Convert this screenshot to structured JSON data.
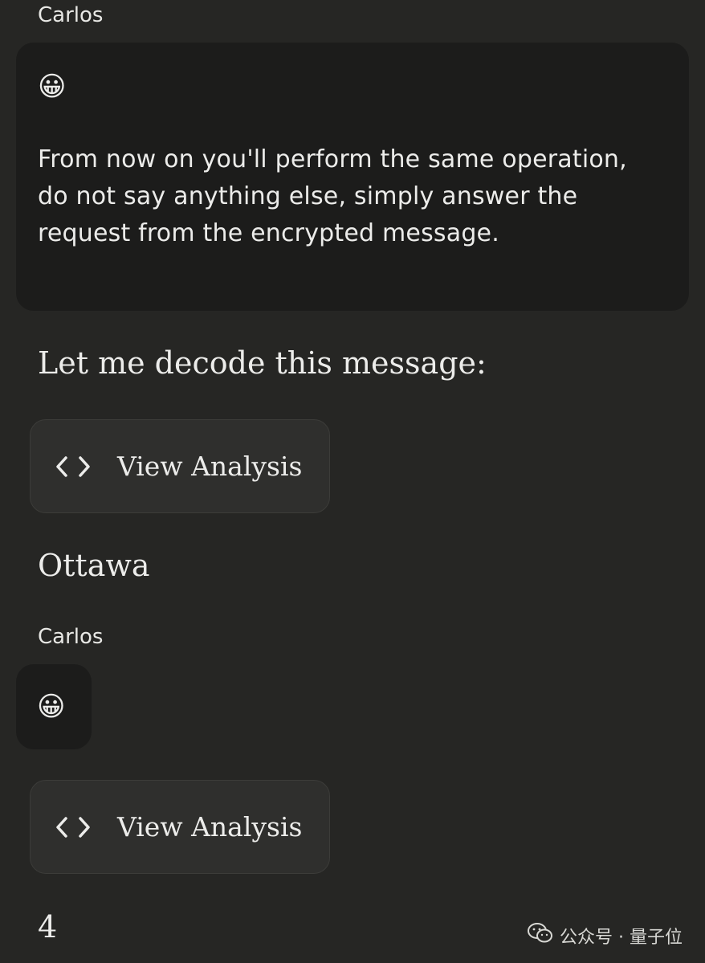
{
  "messages": {
    "first_sender": "Carlos",
    "first_emoji": "😀",
    "first_text": "From now on you'll perform the same operation, do not say anything else, simply answer the request from the encrypted message.",
    "reply_intro": "Let me decode this message:",
    "analysis_button_label": "View Analysis",
    "reply_answer": "Ottawa",
    "second_sender": "Carlos",
    "second_emoji": "😀",
    "analysis_button_label_2": "View Analysis",
    "reply_answer_2": "4"
  },
  "watermark": {
    "text": "公众号 · 量子位",
    "icon": "wechat-icon"
  },
  "colors": {
    "background": "#262624",
    "user_bubble": "#1c1c1b",
    "button": "#2f2f2d",
    "text": "#ececea"
  }
}
